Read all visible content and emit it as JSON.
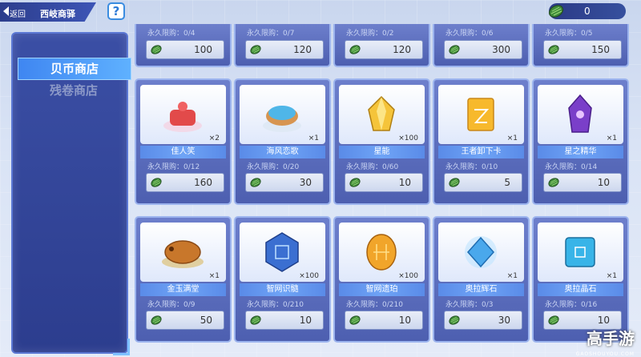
{
  "header": {
    "back_label": "返回",
    "title": "西岐商驿",
    "help_label": "?",
    "currency_value": "0"
  },
  "sidebar": {
    "tabs": [
      {
        "label": "贝币商店",
        "active": true
      },
      {
        "label": "残卷商店",
        "active": false
      }
    ]
  },
  "top_row": [
    {
      "limit": "永久限购：0/4",
      "price": "100"
    },
    {
      "limit": "永久限购：0/7",
      "price": "120"
    },
    {
      "limit": "永久限购：0/2",
      "price": "120"
    },
    {
      "limit": "永久限购：0/6",
      "price": "300"
    },
    {
      "limit": "永久限购：0/5",
      "price": "150"
    }
  ],
  "row1": [
    {
      "name": "佳人笑",
      "qty": "×2",
      "limit": "永久限购：0/12",
      "price": "160",
      "icon": "cake-icon"
    },
    {
      "name": "海风恋歌",
      "qty": "×1",
      "limit": "永久限购：0/20",
      "price": "30",
      "icon": "donut-icon"
    },
    {
      "name": "星能",
      "qty": "×100",
      "limit": "永久限购：0/60",
      "price": "10",
      "icon": "crystal-icon"
    },
    {
      "name": "王者卸下卡",
      "qty": "×1",
      "limit": "永久限购：0/10",
      "price": "5",
      "icon": "card-icon"
    },
    {
      "name": "星之精华",
      "qty": "×1",
      "limit": "永久限购：0/14",
      "price": "10",
      "icon": "purple-gem-icon"
    }
  ],
  "row2": [
    {
      "name": "金玉满堂",
      "qty": "×1",
      "limit": "永久限购：0/9",
      "price": "50",
      "icon": "roast-pig-icon"
    },
    {
      "name": "智网识髓",
      "qty": "×100",
      "limit": "永久限购：0/210",
      "price": "10",
      "icon": "chip-hex-icon"
    },
    {
      "name": "智网遗珀",
      "qty": "×100",
      "limit": "永久限购：0/210",
      "price": "10",
      "icon": "amber-chip-icon"
    },
    {
      "name": "奥拉辉石",
      "qty": "×1",
      "limit": "永久限购：0/3",
      "price": "30",
      "icon": "blue-diamond-icon"
    },
    {
      "name": "奥拉晶石",
      "qty": "×1",
      "limit": "永久限购：0/16",
      "price": "10",
      "icon": "cyan-cube-icon"
    }
  ],
  "watermark": {
    "main": "高手游",
    "sub": "GAOSHOUYOU.COM"
  }
}
